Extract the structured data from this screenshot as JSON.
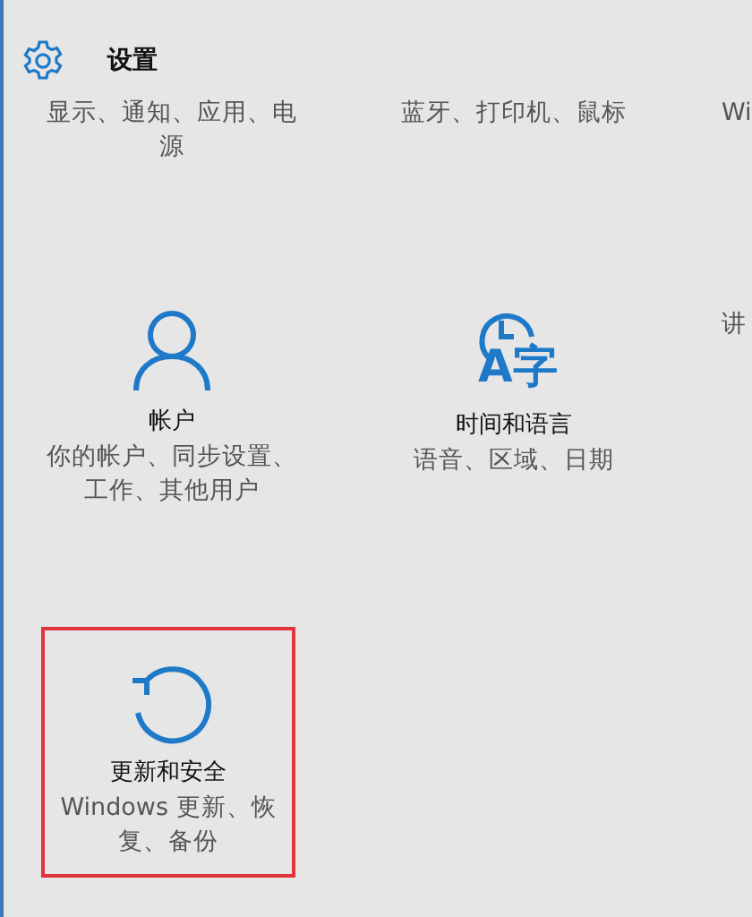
{
  "header": {
    "title": "设置"
  },
  "rows": [
    {
      "tiles": [
        {
          "kind": "plain",
          "description": "显示、通知、应用、电源",
          "highlighted": false
        },
        {
          "kind": "plain",
          "description": "蓝牙、打印机、鼠标",
          "highlighted": false
        },
        {
          "kind": "plain",
          "description": "Wi",
          "highlighted": false
        }
      ]
    },
    {
      "tiles": [
        {
          "kind": "person",
          "title": "帐户",
          "description": "你的帐户、同步设置、工作、其他用户",
          "highlighted": false
        },
        {
          "kind": "clock",
          "icon_text": "A字",
          "title": "时间和语言",
          "description": "语音、区域、日期",
          "highlighted": false
        },
        {
          "kind": "plain",
          "description": "讲",
          "highlighted": false
        }
      ]
    },
    {
      "tiles": [
        {
          "kind": "refresh",
          "title": "更新和安全",
          "description": "Windows 更新、恢复、备份",
          "highlighted": true
        }
      ]
    }
  ]
}
